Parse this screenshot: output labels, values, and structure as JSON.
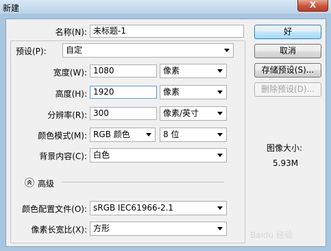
{
  "window": {
    "title": "新建",
    "close": "X"
  },
  "name": {
    "label": "名称(N):",
    "value": "未标题-1"
  },
  "preset": {
    "label": "预设(P):",
    "value": "自定"
  },
  "width": {
    "label": "宽度(W):",
    "value": "1080",
    "unit": "像素"
  },
  "height": {
    "label": "高度(H):",
    "value": "1920",
    "unit": "像素"
  },
  "resolution": {
    "label": "分辨率(R):",
    "value": "300",
    "unit": "像素/英寸"
  },
  "color_mode": {
    "label": "颜色模式(M):",
    "value": "RGB 颜色",
    "depth": "8 位"
  },
  "background": {
    "label": "背景内容(C):",
    "value": "白色"
  },
  "advanced": {
    "label": "高级"
  },
  "color_profile": {
    "label": "颜色配置文件(O):",
    "value": "sRGB IEC61966-2.1"
  },
  "pixel_aspect": {
    "label": "像素长宽比(X):",
    "value": "方形"
  },
  "buttons": {
    "ok": "好",
    "cancel": "取消",
    "save_preset": "存储预设(S)...",
    "delete_preset": "删除预设(D)..."
  },
  "image_size": {
    "label": "图像大小:",
    "value": "5.93M"
  },
  "watermark": "Baidu 经验"
}
